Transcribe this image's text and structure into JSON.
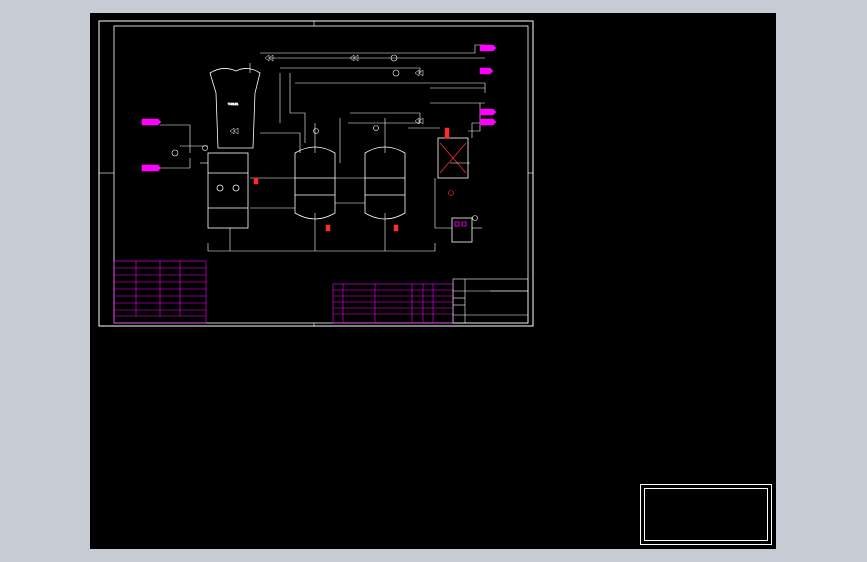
{
  "diagram": {
    "colors": {
      "background": "#000000",
      "frame": "#ffffff",
      "piping": "#ffffff",
      "table": "#ff00ff",
      "instrument": "#ff00ff",
      "highlight": "#ff2a2a"
    },
    "note_text": "",
    "watermark": {
      "line1": "",
      "line2": "",
      "line3": "",
      "line4": "",
      "line5": ""
    }
  }
}
